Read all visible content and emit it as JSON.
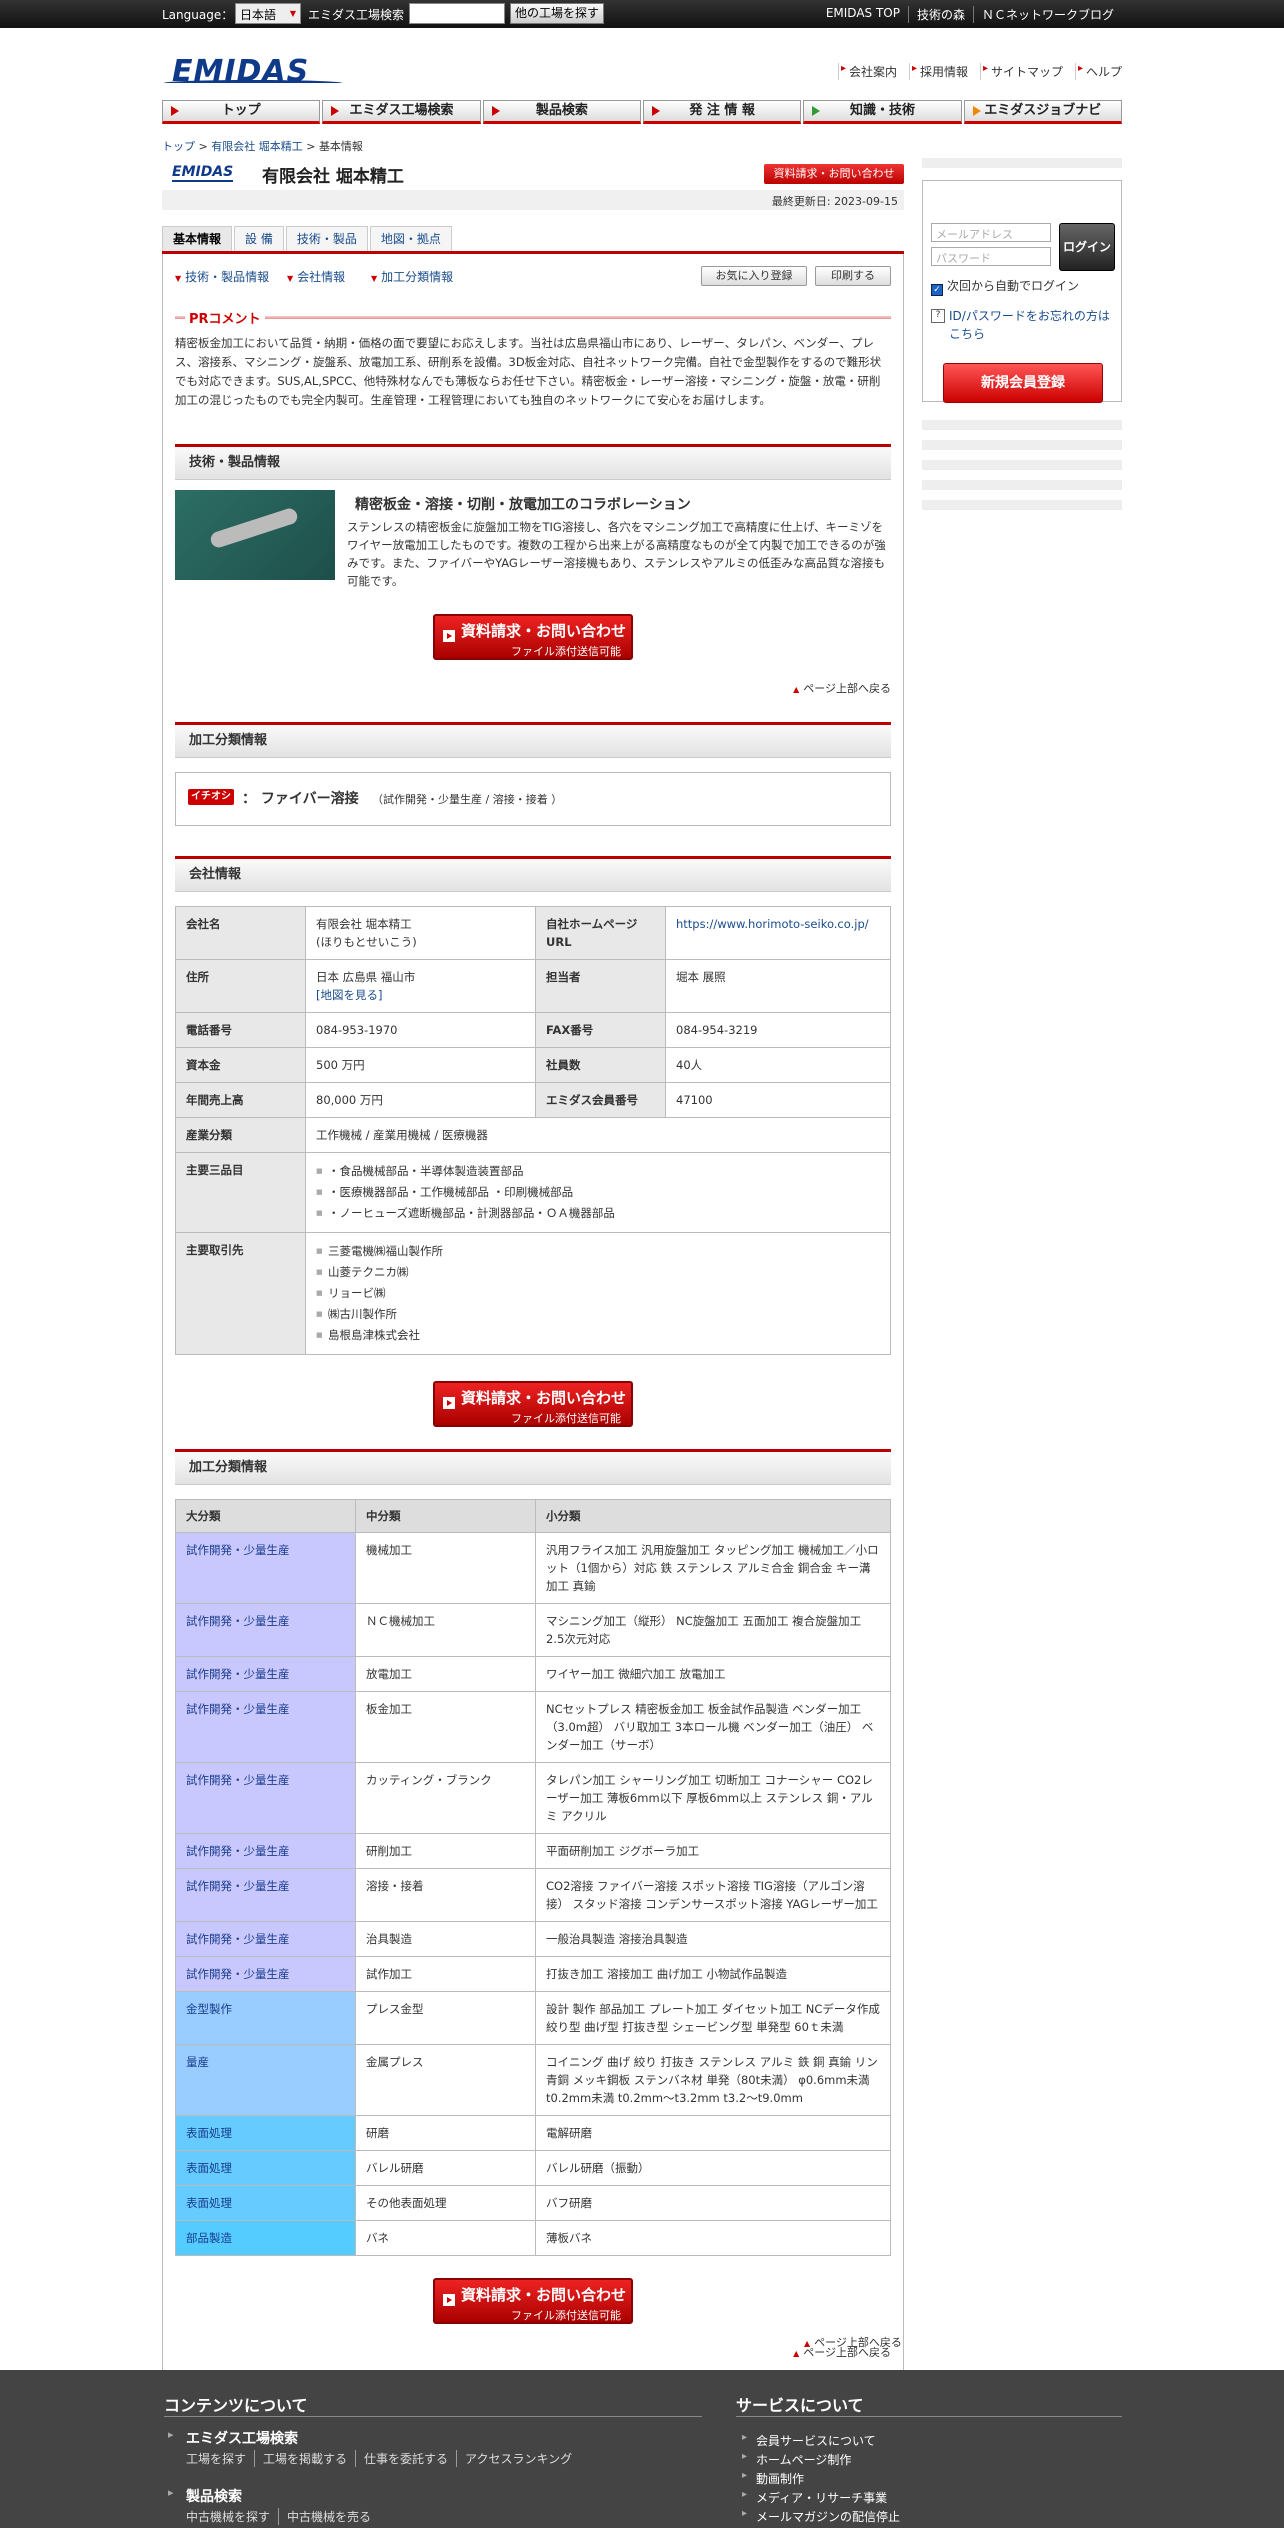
{
  "topbar": {
    "language_label": "Language：",
    "language_value": "日本語",
    "search_label": "エミダス工場検索",
    "search_button": "他の工場を探す",
    "links": [
      "EMIDAS TOP",
      "技術の森",
      "ＮＣネットワークブログ"
    ]
  },
  "logo": "EMIDAS",
  "header_links": [
    "会社案内",
    "採用情報",
    "サイトマップ",
    "ヘルプ"
  ],
  "gnav": [
    "トップ",
    "エミダス工場検索",
    "製品検索",
    "発 注 情 報",
    "知識・技術",
    "エミダスジョブナビ"
  ],
  "breadcrumb": {
    "a": "トップ",
    "b": "有限会社 堀本精工",
    "sep": " > ",
    "c": "基本情報"
  },
  "company": {
    "title": "有限会社 堀本精工",
    "emidas_small": "EMIDAS",
    "request_small": "資料請求・お問い合わせ",
    "updated_label": "最終更新日:",
    "updated": "2023-09-15"
  },
  "tabs": [
    "基本情報",
    "設 備",
    "技術・製品",
    "地図・拠点"
  ],
  "sublinks": [
    "技術・製品情報",
    "会社情報",
    "加工分類情報"
  ],
  "fav_button": "お気に入り登録",
  "print_button": "印刷する",
  "pr": {
    "label": "PRコメント",
    "text": "精密板金加工において品質・納期・価格の面で要望にお応えします。当社は広島県福山市にあり、レーザー、タレパン、ベンダー、プレス、溶接系、マシニング・旋盤系、放電加工系、研削系を設備。3D板金対応、自社ネットワーク完備。自社で金型製作をするので難形状でも対応できます。SUS,AL,SPCC、他特殊材なんでも薄板ならお任せ下さい。精密板金・レーザー溶接・マシニング・旋盤・放電・研削加工の混じったものでも完全内製可。生産管理・工程管理においても独自のネットワークにて安心をお届けします。"
  },
  "tech": {
    "heading": "技術・製品情報",
    "title": "精密板金・溶接・切削・放電加工のコラボレーション",
    "desc": "ステンレスの精密板金に旋盤加工物をTIG溶接し、各穴をマシニング加工で高精度に仕上げ、キーミゾをワイヤー放電加工したものです。複数の工程から出来上がる高精度なものが全て内製で加工できるのが強みです。また、ファイバーやYAGレーザー溶接機もあり、ステンレスやアルミの低歪みな高品質な溶接も可能です。"
  },
  "bigbutton": {
    "l1": "資料請求・お問い合わせ",
    "l2": "ファイル添付送信可能"
  },
  "totop": "ページ上部へ戻る",
  "cat": {
    "heading": "加工分類情報",
    "badge": "イチオシ 1",
    "name": "ファイバー溶接",
    "colon": "：",
    "sub": "（試作開発・少量生産 / 溶接・接着 ）"
  },
  "info": {
    "heading": "会社情報",
    "name_h": "会社名",
    "name": "有限会社 堀本精工",
    "kana": "(ほりもとせいこう)",
    "hp_h": "自社ホームページURL",
    "hp": "https://www.horimoto-seiko.co.jp/",
    "addr_h": "住所",
    "addr": "日本 広島県 福山市",
    "map": "[地図を見る]",
    "rep_h": "担当者",
    "rep": "堀本 展照",
    "tel_h": "電話番号",
    "tel": "084-953-1970",
    "fax_h": "FAX番号",
    "fax": "084-954-3219",
    "cap_h": "資本金",
    "cap": "500 万円",
    "emp_h": "社員数",
    "emp": "40人",
    "sales_h": "年間売上高",
    "sales": "80,000 万円",
    "mem_h": "エミダス会員番号",
    "mem": "47100",
    "ind_h": "産業分類",
    "ind": "工作機械 / 産業用機械 / 医療機器",
    "prod_h": "主要三品目",
    "prods": [
      "・食品機械部品・半導体製造装置部品",
      "・医療機器部品・工作機械部品 ・印刷機械部品",
      "・ノーヒューズ遮断機部品・計測器部品・ＯＡ機器部品"
    ],
    "cli_h": "主要取引先",
    "clients": [
      "三菱電機㈱福山製作所",
      "山菱テクニカ㈱",
      "リョービ㈱",
      "㈱古川製作所",
      "島根島津株式会社"
    ]
  },
  "proc": {
    "heading": "加工分類情報",
    "cols": [
      "大分類",
      "中分類",
      "小分類"
    ],
    "rows": [
      [
        "試作開発・少量生産",
        "機械加工",
        "汎用フライス加工 汎用旋盤加工 タッピング加工 機械加工／小ロット（1個から）対応 鉄 ステンレス アルミ合金 銅合金 キー溝加工 真鍮"
      ],
      [
        "試作開発・少量生産",
        "ＮＣ機械加工",
        "マシニング加工（縦形） NC旋盤加工 五面加工 複合旋盤加工 2.5次元対応"
      ],
      [
        "試作開発・少量生産",
        "放電加工",
        "ワイヤー加工 微細穴加工 放電加工"
      ],
      [
        "試作開発・少量生産",
        "板金加工",
        "NCセットプレス 精密板金加工 板金試作品製造 ベンダー加工（3.0m超） バリ取加工 3本ロール機 ベンダー加工（油圧） ベンダー加工（サーボ）"
      ],
      [
        "試作開発・少量生産",
        "カッティング・ブランク",
        "タレパン加工 シャーリング加工 切断加工 コナーシャー CO2レーザー加工 薄板6mm以下 厚板6mm以上 ステンレス 銅・アルミ アクリル"
      ],
      [
        "試作開発・少量生産",
        "研削加工",
        "平面研削加工 ジグボーラ加工"
      ],
      [
        "試作開発・少量生産",
        "溶接・接着",
        "CO2溶接 ファイバー溶接 スポット溶接 TIG溶接（アルゴン溶接） スタッド溶接 コンデンサースポット溶接 YAGレーザー加工"
      ],
      [
        "試作開発・少量生産",
        "治具製造",
        "一般治具製造 溶接治具製造"
      ],
      [
        "試作開発・少量生産",
        "試作加工",
        "打抜き加工 溶接加工 曲げ加工 小物試作品製造"
      ],
      [
        "金型製作",
        "プレス金型",
        "設計 製作 部品加工 プレート加工 ダイセット加工 NCデータ作成 絞り型 曲げ型 打抜き型 シェービング型 単発型 60ｔ未満"
      ],
      [
        "量産",
        "金属プレス",
        "コイニング 曲げ 絞り 打抜き ステンレス アルミ 鉄 銅 真鍮 リン青銅 メッキ鋼板 ステンバネ材 単発（80t未満） φ0.6mm未満 t0.2mm未満 t0.2mm～t3.2mm t3.2～t9.0mm"
      ],
      [
        "表面処理",
        "研磨",
        "電解研磨"
      ],
      [
        "表面処理",
        "バレル研磨",
        "バレル研磨（振動）"
      ],
      [
        "表面処理",
        "その他表面処理",
        "バフ研磨"
      ],
      [
        "部品製造",
        "バネ",
        "薄板バネ"
      ]
    ]
  },
  "colors": {
    "cat_trial": "#c8c8ff",
    "cat_mold": "#99ccff",
    "cat_mass": "#99ccff",
    "cat_surface": "#66ccff",
    "cat_parts": "#55ccff",
    "accent": "#cc0000"
  },
  "login": {
    "email_ph": "メールアドレス",
    "pw_ph": "パスワード",
    "button": "ログイン",
    "auto": "次回から自動でログイン",
    "forgot": "ID/パスワードをお忘れの方はこちら",
    "register": "新規会員登録"
  },
  "footer": {
    "h1": "コンテンツについて",
    "h2": "サービスについて",
    "b1": "エミダス工場検索",
    "s1": [
      "工場を探す",
      "工場を掲載する",
      "仕事を委託する",
      "アクセスランキング"
    ],
    "b2": "製品検索",
    "s2": [
      "中古機械を探す",
      "中古機械を売る"
    ],
    "services": [
      "会員サービスについて",
      "ホームページ制作",
      "動画制作",
      "メディア・リサーチ事業",
      "メールマガジンの配信停止"
    ]
  }
}
